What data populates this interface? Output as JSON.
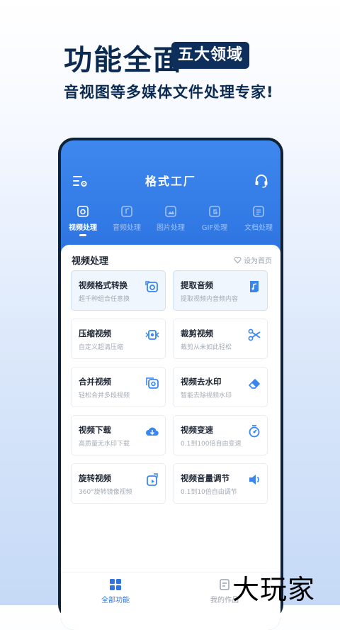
{
  "promo": {
    "title": "功能全面",
    "tag": "五大领域",
    "subtitle": "音视图等多媒体文件处理专家!"
  },
  "app": {
    "title": "格式工厂",
    "menu_icon": "menu-settings-icon",
    "support_icon": "headset-icon"
  },
  "categories": [
    {
      "label": "视频处理",
      "icon": "video-icon"
    },
    {
      "label": "音频处理",
      "icon": "audio-icon"
    },
    {
      "label": "图片处理",
      "icon": "image-icon"
    },
    {
      "label": "GIF处理",
      "icon": "gif-icon"
    },
    {
      "label": "文档处理",
      "icon": "document-icon"
    }
  ],
  "panel": {
    "title": "视频处理",
    "set_home": "设为首页"
  },
  "tools": [
    {
      "title": "视频格式转换",
      "desc": "超千种组合任意换",
      "icon": "video-convert-icon"
    },
    {
      "title": "提取音频",
      "desc": "提取视频内音频内容",
      "icon": "extract-audio-icon"
    },
    {
      "title": "压缩视频",
      "desc": "自定义超清压缩",
      "icon": "compress-icon"
    },
    {
      "title": "裁剪视频",
      "desc": "裁剪从未如此轻松",
      "icon": "scissors-icon"
    },
    {
      "title": "合并视频",
      "desc": "轻松合并多段视频",
      "icon": "merge-icon"
    },
    {
      "title": "视频去水印",
      "desc": "智能去除视频水印",
      "icon": "eraser-icon"
    },
    {
      "title": "视频下载",
      "desc": "高质量无水印下载",
      "icon": "download-icon"
    },
    {
      "title": "视频变速",
      "desc": "0.1到100倍自由变速",
      "icon": "speed-icon"
    },
    {
      "title": "旋转视频",
      "desc": "360°旋转镜像视频",
      "icon": "rotate-icon"
    },
    {
      "title": "视频音量调节",
      "desc": "0.1到10倍自由调节",
      "icon": "volume-icon"
    }
  ],
  "bottom_nav": [
    {
      "label": "全部功能",
      "icon": "grid-icon",
      "active": true
    },
    {
      "label": "我的作品",
      "icon": "works-icon",
      "active": false
    }
  ],
  "watermark": "大玩家",
  "colors": {
    "accent": "#2e75e2",
    "navy": "#0e2f5c",
    "icon_blue": "#3a86f0"
  }
}
